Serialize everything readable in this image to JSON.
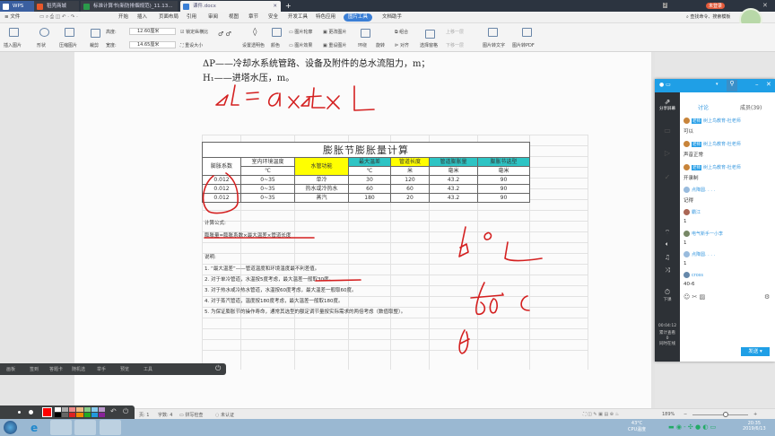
{
  "titlebar": {
    "tabs": [
      "WPS",
      "稻壳商城",
      "标准计算书(新防排烟规范)_11.13...",
      "课件.docx"
    ],
    "badge": "2",
    "login": "未登录"
  },
  "menu": {
    "file": "文件",
    "items": [
      "开始",
      "插入",
      "页面布局",
      "引用",
      "审阅",
      "视图",
      "章节",
      "安全",
      "开发工具",
      "特色应用",
      "图片工具",
      "文档助手"
    ],
    "search": "查找命令、搜索模板"
  },
  "ribbon": {
    "insert_picture": "插入图片",
    "shape": "形状",
    "compress": "压缩图片",
    "crop": "裁剪",
    "height_label": "高度:",
    "height": "12.60厘米",
    "width_label": "宽度:",
    "width": "14.65厘米",
    "lock_ratio": "锁定纵横比",
    "reset_size": "重设大小",
    "transparent": "设置透明色",
    "color": "颜色",
    "outline": "图片轮廓",
    "effect": "图片效果",
    "change": "更改图片",
    "reset_pic": "重设图片",
    "wrap": "环绕",
    "rotate": "旋转",
    "group": "组合",
    "align": "对齐",
    "pane": "选择窗格",
    "up": "上移一层",
    "down": "下移一层",
    "to_text": "图片转文字",
    "to_pdf": "图片转PDF"
  },
  "doc": {
    "line1": "ΔP——冷却水系统管路、设备及附件的总水流阻力，m；",
    "line2": "H₁——进塔水压，m。",
    "table": {
      "title": "膨胀节膨胀量计算",
      "headers": [
        "膨胀系数",
        "室内环境温度",
        "水管功能",
        "最大温差",
        "管道长度",
        "管道膨胀量",
        "膨胀节选型"
      ],
      "units": [
        "℃",
        "℃",
        "米",
        "毫米",
        "毫米"
      ],
      "rows": [
        [
          "0.012",
          "0~35",
          "单冷",
          "30",
          "120",
          "43.2",
          "90"
        ],
        [
          "0.012",
          "0~35",
          "热水或冷热水",
          "60",
          "60",
          "43.2",
          "90"
        ],
        [
          "0.012",
          "0~35",
          "蒸汽",
          "180",
          "20",
          "43.2",
          "90"
        ]
      ]
    },
    "formula_label": "计算公式:",
    "formula": "膨胀量=膨胀系数×最大温差×管道长度",
    "notes_label": "说明:",
    "notes": [
      "1.   “最大温差”——管道温度和环境温度最不利差值。",
      "2.     对于单冷管道，水温按5度考虑，最大温差一般取30度。",
      "3.     对于热水或冷热水管道，水温按60度考虑，最大温差一般取60度。",
      "4.     对于蒸汽管道，温度按180度考虑，最大温差一般取180度。",
      "5.     为保证膨胀节的操作寿命，通常其选型的额定调节量按实际需求的两倍考虑（数值取整）。"
    ]
  },
  "ink_color": "#d42020",
  "floatbar": [
    "画板",
    "签到",
    "答题卡",
    "随机选",
    "举手",
    "预览",
    "工具"
  ],
  "status": {
    "page": "页: 1",
    "words": "字数: 4",
    "spell": "拼写检查",
    "cert": "未认证",
    "zoom": "189%"
  },
  "chat": {
    "tabs": [
      "讨论",
      "成员(39)"
    ],
    "side": [
      "分享屏幕",
      "下课",
      "00:04:12",
      "累计查看",
      "0",
      "同时在线"
    ],
    "messages": [
      {
        "name": "树上鸟教育-杜老师",
        "badge": "老师",
        "text": "可以"
      },
      {
        "name": "树上鸟教育-杜老师",
        "badge": "老师",
        "text": "声音正常"
      },
      {
        "name": "树上鸟教育-杜老师",
        "badge": "老师",
        "text": "开录制"
      },
      {
        "name": "点降圆. . . .",
        "text": "记得"
      },
      {
        "name": "霸江",
        "text": "1"
      },
      {
        "name": "电气新手一小李",
        "text": "1"
      },
      {
        "name": "点降圆. . . .",
        "text": "1"
      },
      {
        "name": "cross",
        "text": "40-6"
      }
    ],
    "send": "发送"
  },
  "taskbar": {
    "temp": "43°C",
    "temp_label": "CPU温度",
    "time": "20:35",
    "date": "2019/6/13"
  }
}
